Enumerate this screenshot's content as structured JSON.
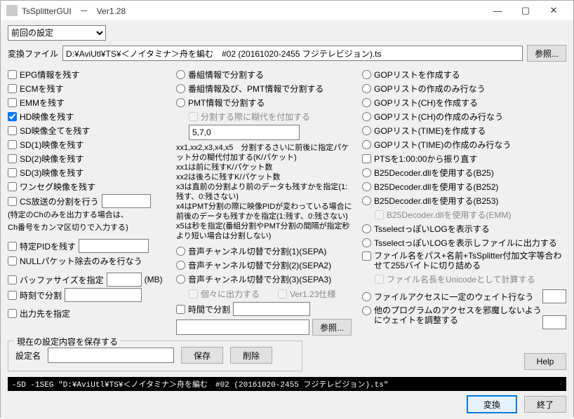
{
  "title": "TsSplitterGUI　－　Ver1.28",
  "preset": "前回の設定",
  "file_label": "変換ファイル",
  "file_value": "D:¥AviUtl¥TS¥＜ノイタミナ＞舟を編む　#02 (20161020-2455 フジテレビジョン).ts",
  "browse": "参照...",
  "left": {
    "epg": "EPG情報を残す",
    "ecm": "ECMを残す",
    "emm": "EMMを残す",
    "hd": "HD映像を残す",
    "sdall": "SD映像全てを残す",
    "sd1": "SD(1)映像を残す",
    "sd2": "SD(2)映像を残す",
    "sd3": "SD(3)映像を残す",
    "oneseg": "ワンセグ映像を残す",
    "cs": "CS放送の分割を行う",
    "cs_note1": "(特定のChのみを出力する場合は、",
    "cs_note2": "Ch番号をカンマ区切りで入力する)",
    "pid": "特定PIDを残す",
    "null": "NULLパケット除去のみを行なう",
    "buf": "バッファサイズを指定",
    "buf_unit": "(MB)",
    "time": "時刻で分割",
    "out": "出力先を指定"
  },
  "mid": {
    "prog": "番組情報で分割する",
    "progpmt": "番組情報及び、PMT情報で分割する",
    "pmt": "PMT情報で分割する",
    "overlap": "分割する際に糊代を付加する",
    "overlap_val": "5,7,0",
    "notes": [
      "xx1,xx2,x3,x4,x5　分割するさいに前後に指定パケット分の糊代付加する(K/パケット)",
      "xx1は前に残すK/パケット数",
      "xx2は後ろに残すK/パケット数",
      "x3は直前の分割より前のデータも残すかを指定(1:残す、0:残さない)",
      "x4はPMT分割の際に映像PIDが変わっている場合に前後のデータも残すかを指定(1:残す、0:残さない)",
      "x5は秒を指定(番組分割やPMT分割の間隔が指定秒より短い場合は分割しない)"
    ],
    "sepa1": "音声チャンネル切替で分割(1)(SEPA)",
    "sepa2": "音声チャンネル切替で分割(2)(SEPA2)",
    "sepa3": "音声チャンネル切替で分割(3)(SEPA3)",
    "indiv": "個々に出力する",
    "v123": "Ver1.23仕様",
    "timespan": "時間で分割"
  },
  "right": {
    "gop_make": "GOPリストを作成する",
    "gop_makeonly": "GOPリストの作成のみ行なう",
    "gop_ch": "GOPリスト(CH)を作成する",
    "gop_chonly": "GOPリスト(CH)の作成のみ行なう",
    "gop_time": "GOPリスト(TIME)を作成する",
    "gop_timeonly": "GOPリスト(TIME)の作成のみ行なう",
    "pts": "PTSを1:00:00から振り直す",
    "b25": "B25Decoder.dllを使用する(B25)",
    "b252": "B25Decoder.dllを使用する(B252)",
    "b253": "B25Decoder.dllを使用する(B253)",
    "emm": "B25Decoder.dllを使用する(EMM)",
    "tslog": "TsselectっぽいLOGを表示する",
    "tslogfile": "TsselectっぽいLOGを表示しファイルに出力する",
    "fname": "ファイル名をパス+名前+TsSplitter付加文字等合わせて255バイトに切り詰める",
    "unicode": "ファイル名長をUnicodeとして計算する",
    "filewait": "ファイルアクセスに一定のウェイト行なう",
    "otherwait": "他のプログラムのアクセスを邪魔しないようにウェイトを調整する"
  },
  "save_group": {
    "legend": "現在の設定内容を保存する",
    "name_lbl": "設定名",
    "save": "保存",
    "delete": "削除"
  },
  "help": "Help",
  "cmdline": "-SD -1SEG \"D:¥AviUtl¥TS¥＜ノイタミナ＞舟を編む　#02 (20161020-2455 フジテレビジョン).ts\"",
  "convert": "変換",
  "exit": "終了"
}
